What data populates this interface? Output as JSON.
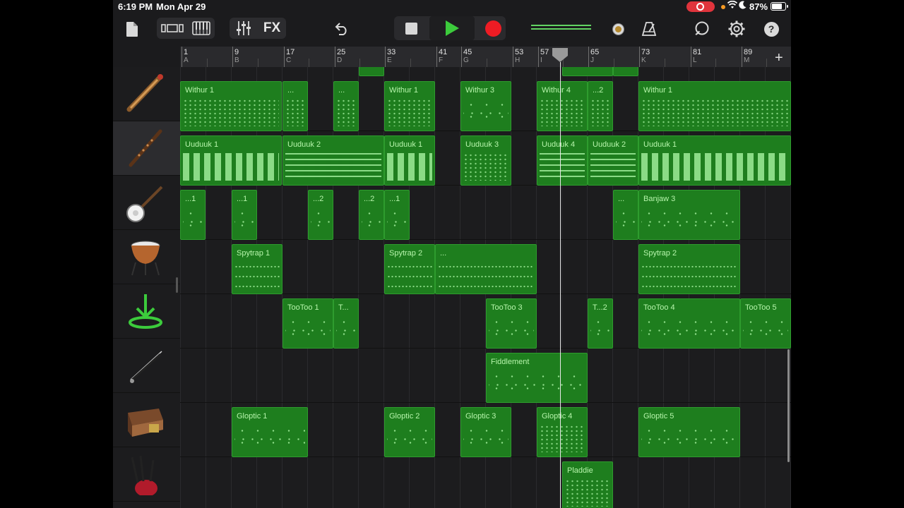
{
  "status": {
    "time": "6:19 PM",
    "date": "Mon Apr 29",
    "battery": "87%",
    "battery_level": 0.87
  },
  "toolbar": {
    "fx_label": "FX",
    "meter_level": 0.9
  },
  "ruler": {
    "bars": [
      {
        "n": "1",
        "s": "A"
      },
      {
        "n": "9",
        "s": "B"
      },
      {
        "n": "17",
        "s": "C"
      },
      {
        "n": "25",
        "s": "D"
      },
      {
        "n": "33",
        "s": "E"
      },
      {
        "n": "41",
        "s": "F"
      },
      {
        "n": "45",
        "s": "G"
      },
      {
        "n": "53",
        "s": "H"
      },
      {
        "n": "57",
        "s": "I"
      },
      {
        "n": "65",
        "s": "J"
      },
      {
        "n": "73",
        "s": "K"
      },
      {
        "n": "81",
        "s": "L"
      },
      {
        "n": "89",
        "s": "M"
      }
    ],
    "add_label": "+"
  },
  "tracks": [
    {
      "instrument": "stringed-instrument-icon",
      "regions": [
        {
          "name": "Withur 1",
          "style": "dots"
        },
        {
          "name": "...",
          "style": "dots"
        },
        {
          "name": "...",
          "style": "dots"
        },
        {
          "name": "Withur 1",
          "style": "dots"
        },
        {
          "name": "Withur 3",
          "style": "sparse"
        },
        {
          "name": "Withur 4",
          "style": "dots"
        },
        {
          "name": "...2",
          "style": "dots"
        },
        {
          "name": "Withur 1",
          "style": "dots"
        }
      ]
    },
    {
      "instrument": "flute-icon",
      "regions": [
        {
          "name": "Uuduuk 1",
          "style": "dash"
        },
        {
          "name": "Uuduuk 2",
          "style": "dash2"
        },
        {
          "name": "Uuduuk 1",
          "style": "dash"
        },
        {
          "name": "Uuduuk 3",
          "style": "dots"
        },
        {
          "name": "Uuduuk 4",
          "style": "dash2"
        },
        {
          "name": "Uuduuk 2",
          "style": "dash2"
        },
        {
          "name": "Uuduuk 1",
          "style": "dash"
        }
      ]
    },
    {
      "instrument": "banjo-icon",
      "regions": [
        {
          "name": "...1",
          "style": "sparse"
        },
        {
          "name": "...1",
          "style": "sparse"
        },
        {
          "name": "...2",
          "style": "sparse"
        },
        {
          "name": "...2",
          "style": "sparse"
        },
        {
          "name": "...1",
          "style": "sparse"
        },
        {
          "name": "...",
          "style": "sparse"
        },
        {
          "name": "Banjaw 3",
          "style": "sparse"
        }
      ]
    },
    {
      "instrument": "timpani-icon",
      "regions": [
        {
          "name": "Spytrap 1",
          "style": "line"
        },
        {
          "name": "Spytrap 2",
          "style": "line"
        },
        {
          "name": "...",
          "style": "line"
        },
        {
          "name": "Spytrap 2",
          "style": "line"
        }
      ]
    },
    {
      "instrument": "download-icon",
      "regions": [
        {
          "name": "TooToo 1",
          "style": "sparse"
        },
        {
          "name": "T...",
          "style": "sparse"
        },
        {
          "name": "TooToo 3",
          "style": "sparse"
        },
        {
          "name": "T...2",
          "style": "sparse"
        },
        {
          "name": "TooToo 4",
          "style": "sparse"
        },
        {
          "name": "TooToo 5",
          "style": "sparse"
        }
      ]
    },
    {
      "instrument": "fiddle-bow-icon",
      "regions": [
        {
          "name": "Fiddlement",
          "style": "sparse"
        }
      ]
    },
    {
      "instrument": "zither-icon",
      "regions": [
        {
          "name": "Gloptic 1",
          "style": "sparse"
        },
        {
          "name": "Gloptic 2",
          "style": "sparse"
        },
        {
          "name": "Gloptic 3",
          "style": "sparse"
        },
        {
          "name": "Gloptic 4",
          "style": "dots"
        },
        {
          "name": "Gloptic 5",
          "style": "sparse"
        }
      ]
    },
    {
      "instrument": "bagpipes-icon",
      "regions": [
        {
          "name": "Pladdie",
          "style": "dots"
        }
      ]
    }
  ]
}
